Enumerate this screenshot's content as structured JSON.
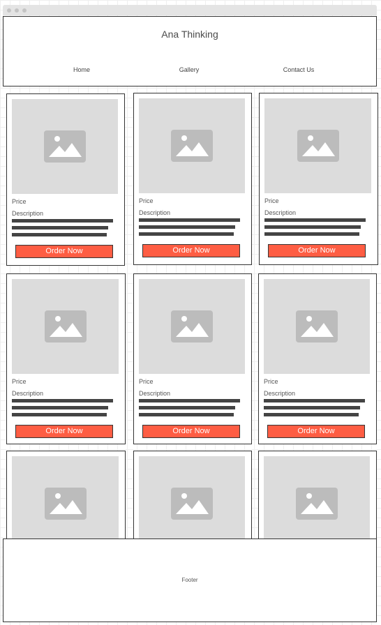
{
  "header": {
    "title": "Ana Thinking",
    "nav": [
      {
        "label": "Home"
      },
      {
        "label": "Gallery"
      },
      {
        "label": "Contact Us"
      }
    ]
  },
  "products": {
    "price_label": "Price",
    "description_label": "Description",
    "button_label": "Order Now",
    "image_icon": "image-placeholder-icon"
  },
  "footer": {
    "text": "Footer"
  },
  "colors": {
    "accent": "#fe5d43",
    "placeholder": "#dcdcdc",
    "placeholder_icon": "#bcbcbc",
    "text_lines": "#444444"
  }
}
